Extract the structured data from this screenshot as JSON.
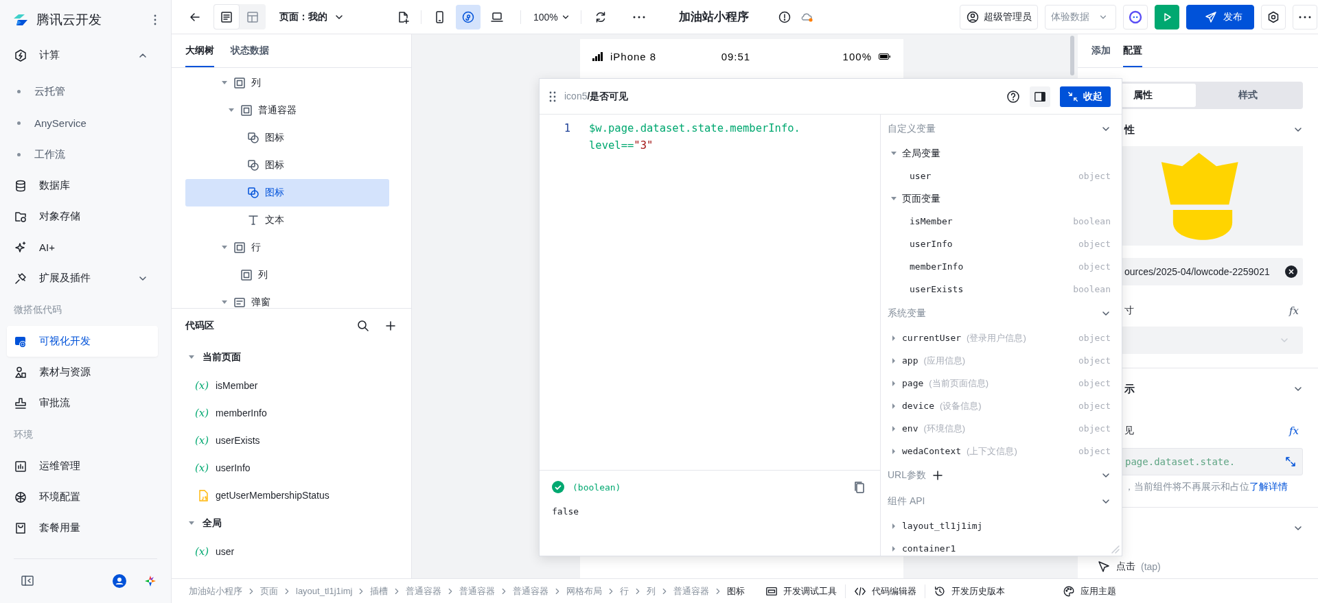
{
  "brand": {
    "name": "腾讯云开发"
  },
  "nav": [
    {
      "kind": "item",
      "label": "计算",
      "expanded": true,
      "selected": false
    },
    {
      "kind": "sub",
      "label": "云托管"
    },
    {
      "kind": "sub",
      "label": "AnyService"
    },
    {
      "kind": "sub",
      "label": "工作流"
    },
    {
      "kind": "item",
      "label": "数据库",
      "selected": false
    },
    {
      "kind": "item",
      "label": "对象存储",
      "selected": false
    },
    {
      "kind": "item",
      "label": "AI+",
      "selected": false
    },
    {
      "kind": "item",
      "label": "扩展及插件",
      "expanded": false,
      "selected": false
    },
    {
      "kind": "section",
      "label": "微搭低代码"
    },
    {
      "kind": "item",
      "label": "可视化开发",
      "selected": true
    },
    {
      "kind": "item",
      "label": "素材与资源",
      "selected": false
    },
    {
      "kind": "item",
      "label": "审批流",
      "selected": false
    },
    {
      "kind": "section",
      "label": "环境"
    },
    {
      "kind": "item",
      "label": "运维管理",
      "selected": false
    },
    {
      "kind": "item",
      "label": "环境配置",
      "selected": false
    },
    {
      "kind": "item",
      "label": "套餐用量",
      "selected": false
    }
  ],
  "topbar": {
    "view_modes": [
      {
        "selected": true
      },
      {
        "selected": false
      }
    ],
    "page_select": "页面：我的",
    "devices": [
      {
        "selected": false
      },
      {
        "selected": true
      },
      {
        "selected": false
      }
    ],
    "zoom": "100%",
    "title": "加油站小程序",
    "role_button": "超级管理员",
    "data_select": "体验数据",
    "publish_button": "发布"
  },
  "outline": {
    "tabs": [
      {
        "label": "大纲树",
        "selected": true
      },
      {
        "label": "状态数据",
        "selected": false
      }
    ],
    "tree": [
      {
        "label": "列",
        "kind": "container",
        "expanded": true,
        "selected": false,
        "children": [
          {
            "label": "普通容器",
            "kind": "container",
            "expanded": true,
            "selected": false,
            "children": [
              {
                "label": "图标",
                "kind": "icon",
                "selected": false
              },
              {
                "label": "图标",
                "kind": "icon",
                "selected": false
              },
              {
                "label": "图标",
                "kind": "icon",
                "selected": true
              },
              {
                "label": "文本",
                "kind": "text",
                "selected": false
              }
            ]
          }
        ]
      },
      {
        "label": "行",
        "kind": "container",
        "expanded": true,
        "selected": false,
        "children": [
          {
            "label": "列",
            "kind": "container",
            "selected": false
          }
        ]
      },
      {
        "label": "弹窗",
        "kind": "modal",
        "expanded": true,
        "selected": false
      }
    ],
    "code_area": {
      "title": "代码区",
      "groups": [
        {
          "title": "当前页面",
          "expanded": true,
          "items": [
            {
              "name": "isMember",
              "kind": "variable",
              "marker": "(x)"
            },
            {
              "name": "memberInfo",
              "kind": "variable",
              "marker": "(x)"
            },
            {
              "name": "userExists",
              "kind": "variable",
              "marker": "(x)"
            },
            {
              "name": "userInfo",
              "kind": "variable",
              "marker": "(x)"
            },
            {
              "name": "getUserMembershipStatus",
              "kind": "script"
            }
          ]
        },
        {
          "title": "全局",
          "expanded": true,
          "items": [
            {
              "name": "user",
              "kind": "variable",
              "marker": "(x)"
            }
          ]
        }
      ]
    }
  },
  "phone": {
    "device": "iPhone 8",
    "time": "09:51",
    "battery": "100%"
  },
  "editor": {
    "path_prefix": "icon5",
    "path_title": "/是否可见",
    "collapse_button": "收起",
    "lines": [
      {
        "number": "1",
        "tokens": [
          {
            "kind": "code",
            "text": "$w.page.dataset.state.memberInfo.level=="
          },
          {
            "kind": "string",
            "text": "\"3\""
          }
        ]
      }
    ],
    "result": {
      "type": "(boolean)",
      "value": "false"
    },
    "variables": [
      {
        "title": "自定义变量",
        "groups": [
          {
            "title": "全局变量",
            "expanded": true,
            "items": [
              {
                "name": "user",
                "type": "object"
              }
            ]
          },
          {
            "title": "页面变量",
            "expanded": true,
            "items": [
              {
                "name": "isMember",
                "type": "boolean"
              },
              {
                "name": "userInfo",
                "type": "object"
              },
              {
                "name": "memberInfo",
                "type": "object"
              },
              {
                "name": "userExists",
                "type": "boolean"
              }
            ]
          }
        ]
      },
      {
        "title": "系统变量",
        "items": [
          {
            "name": "currentUser",
            "desc": "(登录用户信息)",
            "type": "object",
            "expanded": false
          },
          {
            "name": "app",
            "desc": "(应用信息)",
            "type": "object",
            "expanded": false
          },
          {
            "name": "page",
            "desc": "(当前页面信息)",
            "type": "object",
            "expanded": false
          },
          {
            "name": "device",
            "desc": "(设备信息)",
            "type": "object",
            "expanded": false
          },
          {
            "name": "env",
            "desc": "(环境信息)",
            "type": "object",
            "expanded": false
          },
          {
            "name": "wedaContext",
            "desc": "(上下文信息)",
            "type": "object",
            "expanded": false
          }
        ]
      },
      {
        "title": "URL参数",
        "addable": true
      },
      {
        "title": "组件 API",
        "items": [
          {
            "name": "layout_tl1j1imj",
            "expanded": false
          },
          {
            "name": "container1",
            "expanded": false
          }
        ]
      }
    ]
  },
  "inspector": {
    "tabs": [
      {
        "label": "添加",
        "selected": false
      },
      {
        "label": "配置",
        "selected": true
      }
    ],
    "segments": [
      {
        "label": "属性",
        "selected": true
      },
      {
        "label": "样式",
        "selected": false
      }
    ],
    "section_title": "性",
    "image_url": "ources/2025-04/lowcode-2259021",
    "size_label": "寸",
    "size_formula": "fx",
    "display_title": "示",
    "visible_label": "见",
    "visible_formula": "fx",
    "visible_expr": "page.dataset.state.",
    "visible_hint": "，当前组件将不再展示和占位",
    "hint_link": "了解详情",
    "event": "点击",
    "event_detail": "(tap)"
  },
  "breadcrumbs": [
    {
      "label": "加油站小程序",
      "selected": false
    },
    {
      "label": "页面",
      "selected": false
    },
    {
      "label": "layout_tl1j1imj",
      "selected": false
    },
    {
      "label": "插槽",
      "selected": false
    },
    {
      "label": "普通容器",
      "selected": false
    },
    {
      "label": "普通容器",
      "selected": false
    },
    {
      "label": "普通容器",
      "selected": false
    },
    {
      "label": "网格布局",
      "selected": false
    },
    {
      "label": "行",
      "selected": false
    },
    {
      "label": "列",
      "selected": false
    },
    {
      "label": "普通容器",
      "selected": false
    },
    {
      "label": "图标",
      "selected": true
    }
  ],
  "tools": [
    {
      "label": "开发调试工具"
    },
    {
      "label": "代码编辑器"
    },
    {
      "label": "开发历史版本"
    },
    {
      "label": "应用主题"
    }
  ]
}
